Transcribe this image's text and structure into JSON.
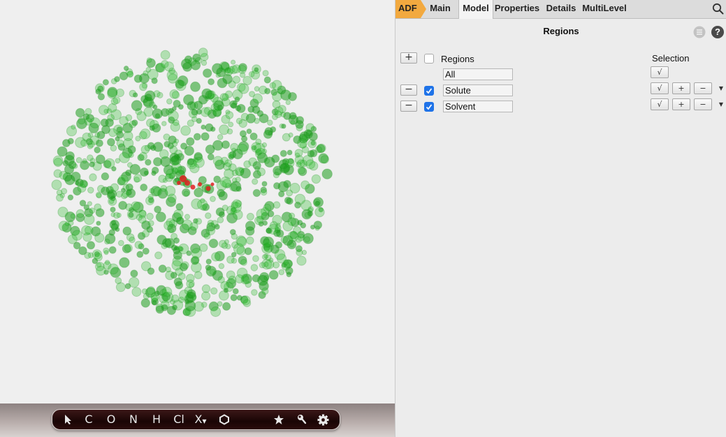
{
  "tabs": [
    {
      "label": "ADF"
    },
    {
      "label": "Main"
    },
    {
      "label": "Model"
    },
    {
      "label": "Properties"
    },
    {
      "label": "Details"
    },
    {
      "label": "MultiLevel"
    }
  ],
  "active_tab": "Model",
  "panel": {
    "title": "Regions",
    "regions_header": "Regions",
    "selection_header": "Selection",
    "add_symbol": "+",
    "remove_symbol": "−",
    "check_symbol": "√",
    "all_label": "All",
    "rows": [
      {
        "name": "Solute",
        "checked": true
      },
      {
        "name": "Solvent",
        "checked": true
      }
    ]
  },
  "toolbar": {
    "items": [
      {
        "name": "select-tool",
        "label": ""
      },
      {
        "name": "carbon-tool",
        "label": "C"
      },
      {
        "name": "oxygen-tool",
        "label": "O"
      },
      {
        "name": "nitrogen-tool",
        "label": "N"
      },
      {
        "name": "hydrogen-tool",
        "label": "H"
      },
      {
        "name": "chlorine-tool",
        "label": "Cl"
      },
      {
        "name": "other-element-tool",
        "label": "X"
      },
      {
        "name": "ring-tool",
        "label": ""
      },
      {
        "name": "favorites-tool",
        "label": ""
      },
      {
        "name": "wrench-tool",
        "label": ""
      },
      {
        "name": "settings-tool",
        "label": ""
      }
    ]
  },
  "colors": {
    "accent_tab": "#f2a93f",
    "checkbox": "#1f73e8",
    "solvent_atom": "#2fbf2f",
    "solute_atom": "#e02020"
  },
  "icons": [
    "search-icon",
    "list-icon",
    "help-icon",
    "pointer-icon",
    "hexagon-icon",
    "star-icon",
    "wrench-icon",
    "gear-icon"
  ]
}
